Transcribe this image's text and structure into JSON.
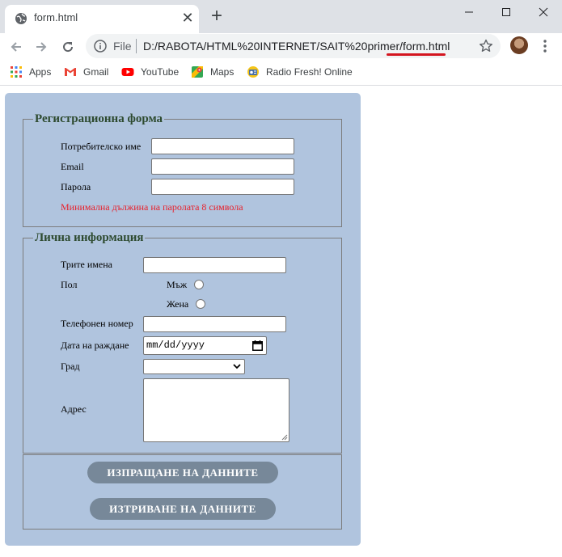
{
  "browser": {
    "tab_title": "form.html",
    "url_scheme": "File",
    "url": "D:/RABOTA/HTML%20INTERNET/SAIT%20primer/form.html",
    "bookmarks": [
      "Apps",
      "Gmail",
      "YouTube",
      "Maps",
      "Radio Fresh! Online"
    ]
  },
  "form": {
    "registration": {
      "legend": "Регистрационна форма",
      "username_label": "Потребителско име",
      "email_label": "Email",
      "password_label": "Парола",
      "password_note": "Минимална дължина на паролата 8 символа"
    },
    "personal": {
      "legend": "Лична информация",
      "fullname_label": "Трите имена",
      "gender_label": "Пол",
      "male_label": "Мъж",
      "female_label": "Жена",
      "phone_label": "Телефонен номер",
      "birthdate_label": "Дата на раждане",
      "birthdate_placeholder": "mm/dd/yyyy",
      "city_label": "Град",
      "city_value": "",
      "address_label": "Адрес"
    },
    "buttons": {
      "submit": "ИЗПРАЩАНЕ НА ДАННИТЕ",
      "reset": "ИЗТРИВАНЕ НА ДАННИТЕ"
    }
  },
  "colors": {
    "form_bg": "#b0c4de",
    "button_bg": "#778899",
    "note_color": "#e8202b",
    "legend_color": "#2d4a2f"
  }
}
